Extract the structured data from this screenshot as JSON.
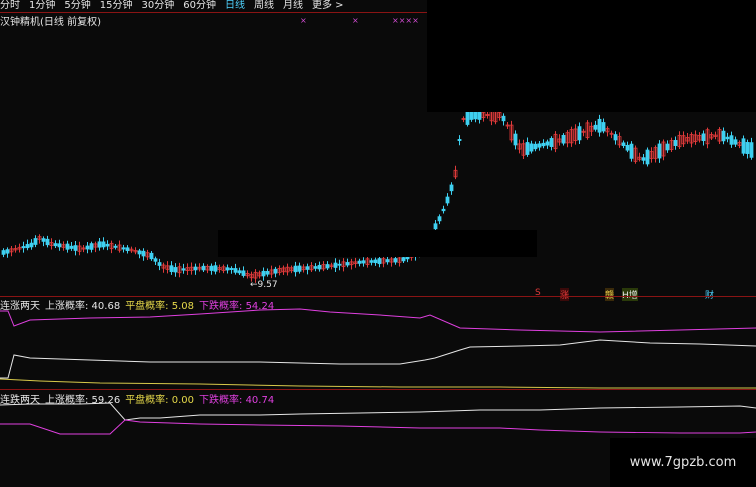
{
  "toolbar": {
    "items": [
      "分时",
      "1分钟",
      "5分钟",
      "15分钟",
      "30分钟",
      "60分钟",
      "日线",
      "周线",
      "月线",
      "更多 >"
    ],
    "active": "日线"
  },
  "main_chart": {
    "title": "汉钟精机(日线 前复权)",
    "low_label": "←9.57",
    "marks": [
      "×",
      "×",
      "××××"
    ]
  },
  "signals": [
    "S",
    "涨",
    "赣",
    "H增",
    "财"
  ],
  "indicator1": {
    "prefix": "连涨两天",
    "up": "上涨概率: 40.68",
    "flat": "平盘概率: 5.08",
    "down": "下跌概率: 54.24"
  },
  "indicator2": {
    "prefix": "连跌两天",
    "up": "上涨概率: 59.26",
    "flat": "平盘概率: 0.00",
    "down": "下跌概率: 40.74"
  },
  "watermark": "www.7gpzb.com",
  "colors": {
    "up": "#e03a3a",
    "down": "#3fd0f0",
    "magenta": "#e040e0",
    "white": "#e6e6e6",
    "yellow": "#d8c94a"
  }
}
